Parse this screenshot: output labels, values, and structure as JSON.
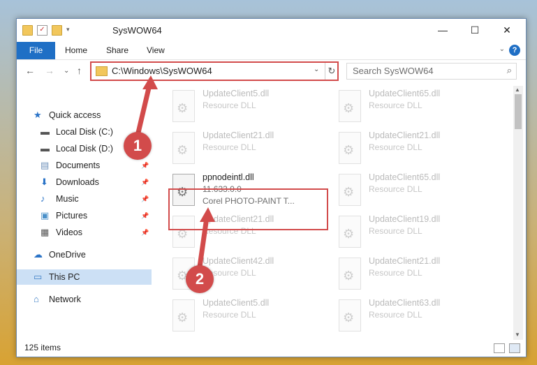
{
  "window": {
    "title": "SysWOW64",
    "minimize": "—",
    "maximize": "☐",
    "close": "✕"
  },
  "ribbon": {
    "tabs": [
      "File",
      "Home",
      "Share",
      "View"
    ],
    "help": "?",
    "collapse": "⌄"
  },
  "nav": {
    "back": "←",
    "forward": "→",
    "recent": "⌄",
    "up": "↑",
    "address": "C:\\Windows\\SysWOW64",
    "address_dropdown": "⌄",
    "refresh": "↻",
    "search_placeholder": "Search SysWOW64",
    "search_icon": "search-icon"
  },
  "sidebar": [
    {
      "label": "Quick access",
      "icon": "star-icon",
      "pinned": false
    },
    {
      "label": "Local Disk (C:)",
      "icon": "drive-icon",
      "pinned": true
    },
    {
      "label": "Local Disk (D:)",
      "icon": "drive-icon",
      "pinned": true
    },
    {
      "label": "Documents",
      "icon": "documents-icon",
      "pinned": true
    },
    {
      "label": "Downloads",
      "icon": "download-icon",
      "pinned": true
    },
    {
      "label": "Music",
      "icon": "music-icon",
      "pinned": true
    },
    {
      "label": "Pictures",
      "icon": "pictures-icon",
      "pinned": true
    },
    {
      "label": "Videos",
      "icon": "videos-icon",
      "pinned": true
    },
    {
      "label": "OneDrive",
      "icon": "cloud-icon",
      "pinned": false
    },
    {
      "label": "This PC",
      "icon": "pc-icon",
      "pinned": false,
      "selected": true
    },
    {
      "label": "Network",
      "icon": "network-icon",
      "pinned": false
    }
  ],
  "files": [
    {
      "name": "UpdateClient5.dll",
      "desc": "Resource DLL"
    },
    {
      "name": "UpdateClient65.dll",
      "desc": "Resource DLL"
    },
    {
      "name": "UpdateClient21.dll",
      "desc": "Resource DLL"
    },
    {
      "name": "UpdateClient21.dll",
      "desc": "Resource DLL"
    },
    {
      "name": "ppnodeintl.dll",
      "version": "11.633.0.0",
      "desc": "Corel PHOTO-PAINT T...",
      "active": true
    },
    {
      "name": "UpdateClient65.dll",
      "desc": "Resource DLL"
    },
    {
      "name": "UpdateClient21.dll",
      "desc": "Resource DLL"
    },
    {
      "name": "UpdateClient19.dll",
      "desc": "Resource DLL"
    },
    {
      "name": "UpdateClient42.dll",
      "desc": "Resource DLL"
    },
    {
      "name": "UpdateClient21.dll",
      "desc": "Resource DLL"
    },
    {
      "name": "UpdateClient5.dll",
      "desc": "Resource DLL"
    },
    {
      "name": "UpdateClient63.dll",
      "desc": "Resource DLL"
    }
  ],
  "status": {
    "count": "125 items"
  },
  "annotations": [
    {
      "label": "1"
    },
    {
      "label": "2"
    }
  ],
  "colors": {
    "accent": "#1f6fc5",
    "highlight": "#d24b4b",
    "selection": "#cce0f5"
  }
}
